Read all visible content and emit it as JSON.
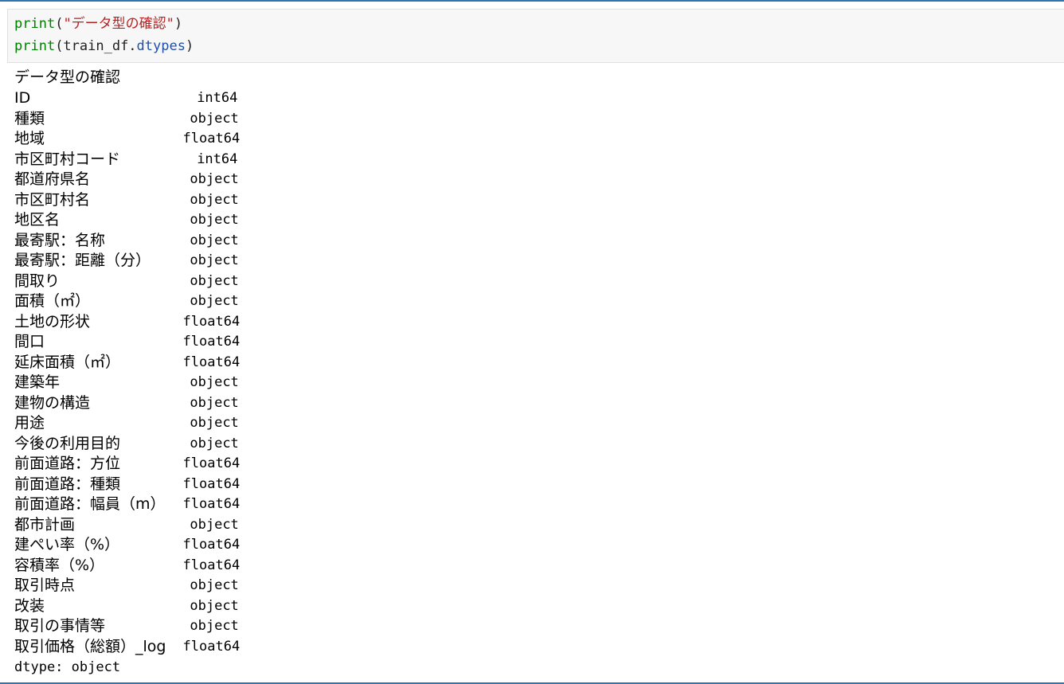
{
  "code": {
    "line1": {
      "fn": "print",
      "open": "(",
      "str": "\"データ型の確認\"",
      "close": ")"
    },
    "line2": {
      "fn": "print",
      "open": "(train_df.",
      "attr": "dtypes",
      "close": ")"
    }
  },
  "output": {
    "header": "データ型の確認",
    "rows": [
      {
        "name": "ID",
        "dtype": "int64"
      },
      {
        "name": "種類",
        "dtype": "object"
      },
      {
        "name": "地域",
        "dtype": "float64"
      },
      {
        "name": "市区町村コード",
        "dtype": "int64"
      },
      {
        "name": "都道府県名",
        "dtype": "object"
      },
      {
        "name": "市区町村名",
        "dtype": "object"
      },
      {
        "name": "地区名",
        "dtype": "object"
      },
      {
        "name": "最寄駅：名称",
        "dtype": "object"
      },
      {
        "name": "最寄駅：距離（分）",
        "dtype": "object"
      },
      {
        "name": "間取り",
        "dtype": "object"
      },
      {
        "name": "面積（㎡）",
        "dtype": "object"
      },
      {
        "name": "土地の形状",
        "dtype": "float64"
      },
      {
        "name": "間口",
        "dtype": "float64"
      },
      {
        "name": "延床面積（㎡）",
        "dtype": "float64"
      },
      {
        "name": "建築年",
        "dtype": "object"
      },
      {
        "name": "建物の構造",
        "dtype": "object"
      },
      {
        "name": "用途",
        "dtype": "object"
      },
      {
        "name": "今後の利用目的",
        "dtype": "object"
      },
      {
        "name": "前面道路：方位",
        "dtype": "float64"
      },
      {
        "name": "前面道路：種類",
        "dtype": "float64"
      },
      {
        "name": "前面道路：幅員（m）",
        "dtype": "float64"
      },
      {
        "name": "都市計画",
        "dtype": "object"
      },
      {
        "name": "建ぺい率（%）",
        "dtype": "float64"
      },
      {
        "name": "容積率（%）",
        "dtype": "float64"
      },
      {
        "name": "取引時点",
        "dtype": "object"
      },
      {
        "name": "改装",
        "dtype": "object"
      },
      {
        "name": "取引の事情等",
        "dtype": "object"
      },
      {
        "name": "取引価格（総額）_log",
        "dtype": "float64"
      }
    ],
    "footer": "dtype: object"
  }
}
